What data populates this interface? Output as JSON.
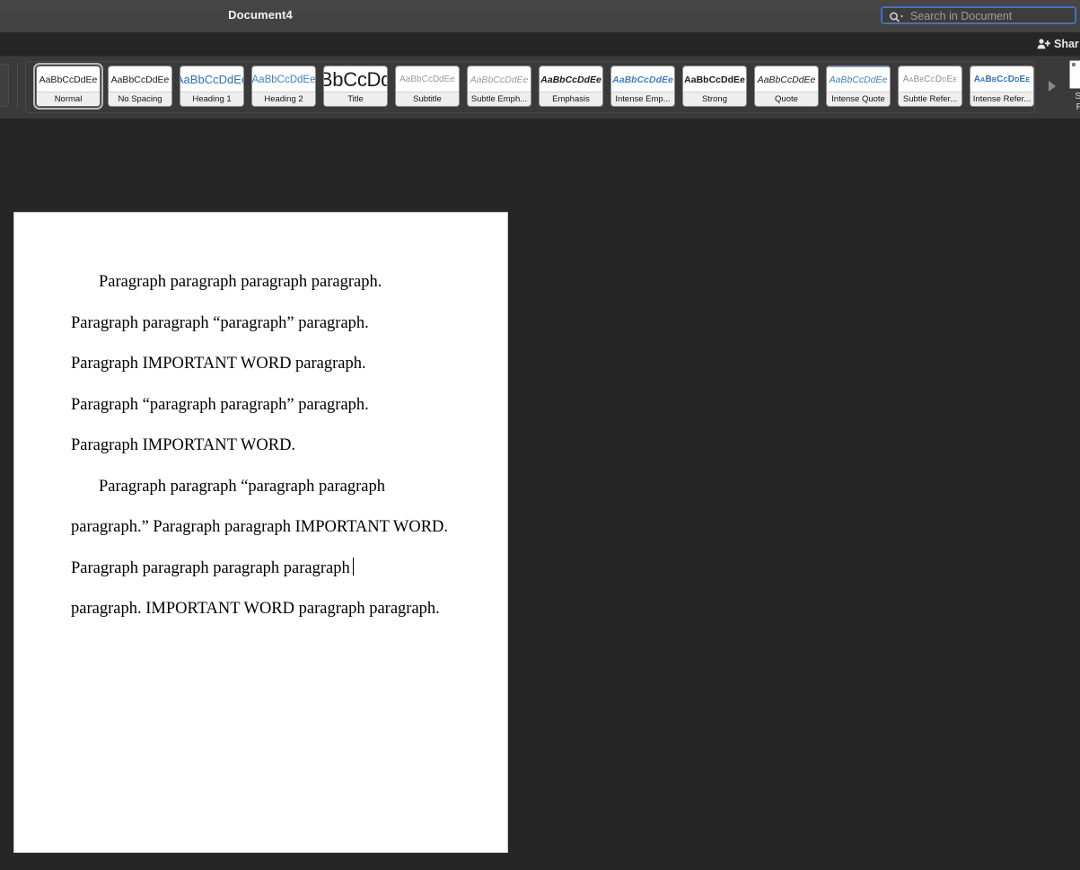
{
  "window": {
    "title": "Document4",
    "background_color": "#262626",
    "titlebar_color": "#434343"
  },
  "search": {
    "placeholder": "Search in Document",
    "value": "",
    "icon": "search-icon",
    "focus_ring_color": "#3a74c8"
  },
  "share": {
    "label": "Shar",
    "icon": "person-add-icon"
  },
  "ribbon": {
    "scroll_arrow_icon": "chevron-right-icon",
    "styles_pane": {
      "line1": "Sty",
      "line2": "Pa"
    },
    "styles": [
      {
        "label": "Normal",
        "preview": "AaBbCcDdEe",
        "variant": "p-normal",
        "selected": true
      },
      {
        "label": "No Spacing",
        "preview": "AaBbCcDdEe",
        "variant": "p-nospace",
        "selected": false
      },
      {
        "label": "Heading 1",
        "preview": "AaBbCcDdEe",
        "variant": "p-h1",
        "selected": false
      },
      {
        "label": "Heading 2",
        "preview": "AaBbCcDdEe",
        "variant": "p-h2",
        "selected": false
      },
      {
        "label": "Title",
        "preview": "AaBbCcDdEe",
        "variant": "p-title",
        "selected": false
      },
      {
        "label": "Subtitle",
        "preview": "AaBbCcDdEe",
        "variant": "p-subtitle",
        "selected": false
      },
      {
        "label": "Subtle Emph...",
        "preview": "AaBbCcDdEe",
        "variant": "p-subtleemph",
        "selected": false
      },
      {
        "label": "Emphasis",
        "preview": "AaBbCcDdEe",
        "variant": "p-emphasis",
        "selected": false
      },
      {
        "label": "Intense Emp...",
        "preview": "AaBbCcDdEe",
        "variant": "p-intenseemph",
        "selected": false
      },
      {
        "label": "Strong",
        "preview": "AaBbCcDdEe",
        "variant": "p-strong",
        "selected": false
      },
      {
        "label": "Quote",
        "preview": "AaBbCcDdEe",
        "variant": "p-quote",
        "selected": false
      },
      {
        "label": "Intense Quote",
        "preview": "AaBbCcDdEe",
        "variant": "p-intensequote",
        "selected": false
      },
      {
        "label": "Subtle Refer...",
        "preview": "AaBbCcDdEe",
        "variant": "p-subtleref",
        "selected": false
      },
      {
        "label": "Intense Refer...",
        "preview": "AaBbCcDdEe",
        "variant": "p-intenseref",
        "selected": false
      }
    ]
  },
  "document": {
    "paragraphs": [
      {
        "indent": true,
        "text": "Paragraph paragraph paragraph paragraph.",
        "caret": false
      },
      {
        "indent": false,
        "text": "Paragraph paragraph “paragraph” paragraph.",
        "caret": false
      },
      {
        "indent": false,
        "text": "Paragraph IMPORTANT WORD paragraph.",
        "caret": false
      },
      {
        "indent": false,
        "text": "Paragraph “paragraph paragraph” paragraph.",
        "caret": false
      },
      {
        "indent": false,
        "text": "Paragraph IMPORTANT WORD.",
        "caret": false
      },
      {
        "indent": true,
        "text": "Paragraph paragraph “paragraph paragraph paragraph.” Paragraph paragraph IMPORTANT WORD. Paragraph paragraph paragraph paragraph",
        "caret": true
      },
      {
        "indent": false,
        "text": "paragraph. IMPORTANT WORD paragraph paragraph.",
        "caret": false
      }
    ]
  }
}
